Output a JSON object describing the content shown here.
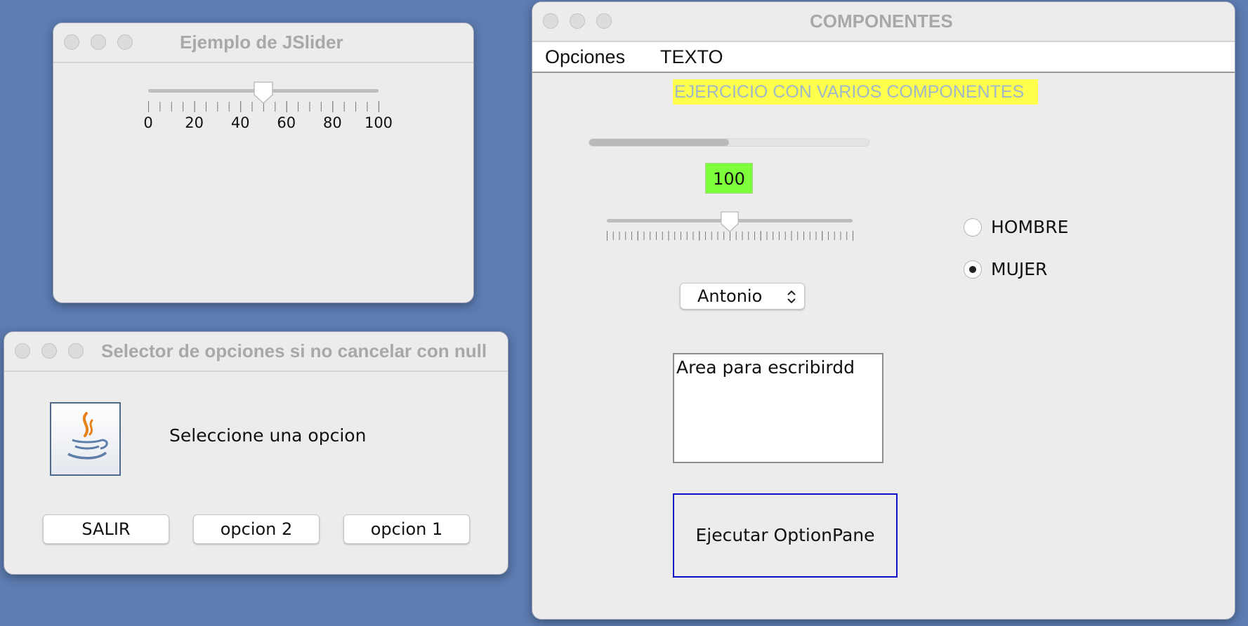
{
  "slider_window": {
    "title": "Ejemplo de JSlider",
    "slider": {
      "min": 0,
      "max": 100,
      "value": 50,
      "tick_labels": [
        "0",
        "20",
        "40",
        "60",
        "80",
        "100"
      ]
    }
  },
  "selector_window": {
    "title": "Selector de opciones si no cancelar con null",
    "message": "Seleccione una opcion",
    "buttons": [
      "SALIR",
      "opcion 2",
      "opcion 1"
    ]
  },
  "components_window": {
    "title": "COMPONENTES",
    "menus": [
      "Opciones",
      "TEXTO"
    ],
    "heading": "EJERCICIO CON VARIOS COMPONENTES",
    "progress": {
      "value": 0.5
    },
    "value_label": "100",
    "slider": {
      "value": 0.5
    },
    "combo": {
      "selected": "Antonio"
    },
    "radios": [
      {
        "label": "HOMBRE",
        "selected": false
      },
      {
        "label": "MUJER",
        "selected": true
      }
    ],
    "textarea": {
      "value": "Area para escribirdd"
    },
    "action_button": "Ejecutar OptionPane"
  },
  "colors": {
    "desktop": "#5d7db3",
    "heading_bg": "#ffff4d",
    "heading_fg": "#9fb8c8",
    "value_label_bg": "#7dff3c",
    "action_button_border": "#1010c8"
  }
}
